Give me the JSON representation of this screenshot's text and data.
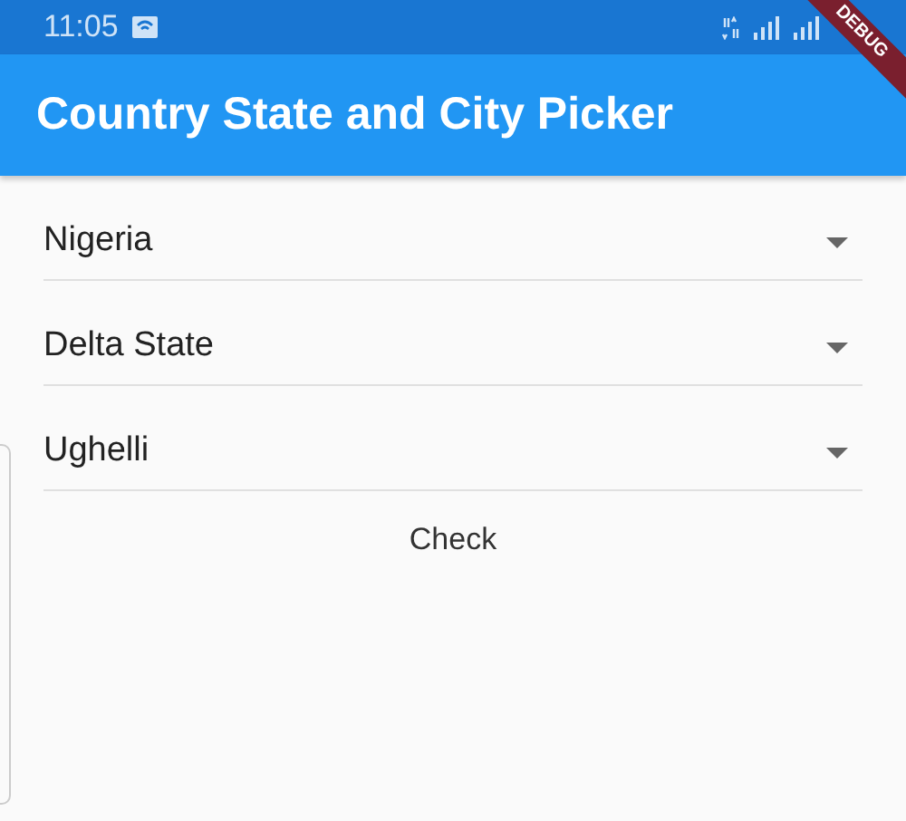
{
  "status_bar": {
    "time": "11:05"
  },
  "debug_banner": "DEBUG",
  "app_bar": {
    "title": "Country State and City Picker"
  },
  "dropdowns": [
    {
      "value": "Nigeria"
    },
    {
      "value": "Delta State"
    },
    {
      "value": "Ughelli"
    }
  ],
  "check_button": "Check"
}
